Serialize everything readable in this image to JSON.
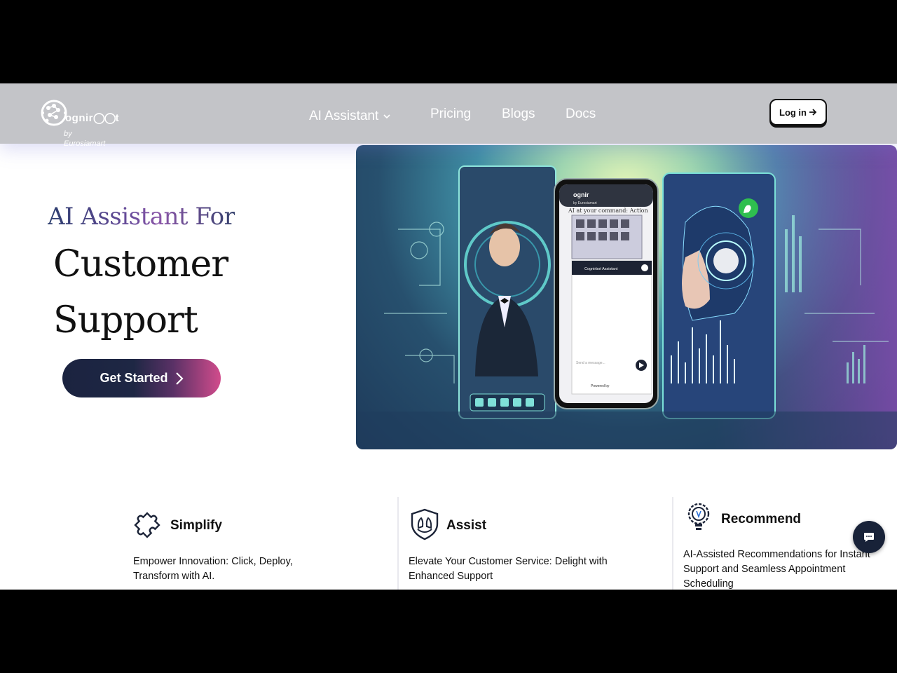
{
  "header": {
    "logo_word": "ognir",
    "logo_suffix": "t",
    "logo_by": "by",
    "logo_company": "Eurosiamart",
    "nav": {
      "ai_assistant": "AI Assistant",
      "pricing": "Pricing",
      "blogs": "Blogs",
      "docs": "Docs"
    },
    "login_label": "Log in",
    "login_icon": "arrow-right-icon"
  },
  "hero": {
    "line1": "AI Assistant For",
    "line2": "Customer",
    "line3": "Support",
    "cta_label": "Get Started",
    "cta_icon": "chevron-right-icon",
    "phone": {
      "brand": "ognir",
      "by": "by Eurosiamart",
      "tagline": "AI at your command: Action",
      "chat_header": "Cognirbot Assistant",
      "input_placeholder": "Send a message...",
      "powered_by": "Powered by"
    }
  },
  "features": [
    {
      "title": "Simplify",
      "icon": "puzzle-icon",
      "desc": "Empower Innovation: Click, Deploy, Transform with AI."
    },
    {
      "title": "Assist",
      "icon": "shield-hands-icon",
      "desc": "Elevate Your Customer Service: Delight with Enhanced Support"
    },
    {
      "title": "Recommend",
      "icon": "lightbulb-gear-icon",
      "desc": "AI-Assisted Recommendations for Instant Support and Seamless Appointment Scheduling"
    }
  ],
  "chat_widget": {
    "icon": "chat-bubble-icon"
  },
  "colors": {
    "header_bg": "#c3c4c8",
    "cta_dark": "#1b2340",
    "cta_pink": "#d14c8c",
    "chat_btn": "#182238"
  }
}
